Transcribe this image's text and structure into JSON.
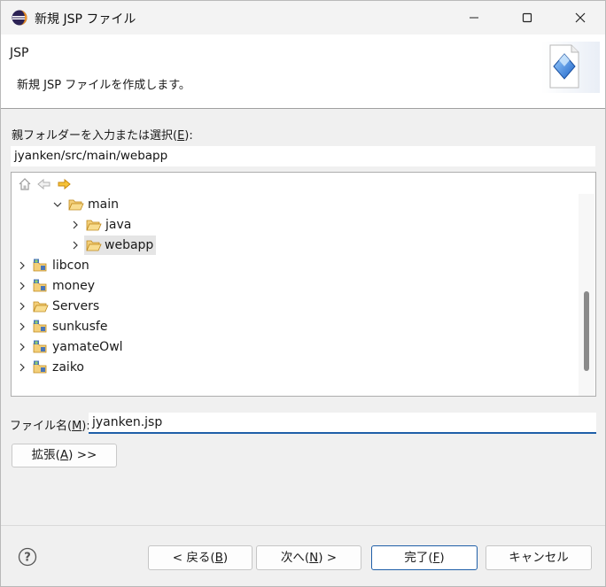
{
  "window": {
    "title": "新規 JSP ファイル"
  },
  "banner": {
    "title": "JSP",
    "description": "新規 JSP ファイルを作成します。"
  },
  "parent_folder": {
    "label_pre": "親フォルダーを入力または選択(",
    "label_key": "E",
    "label_post": "):",
    "value": "jyanken/src/main/webapp"
  },
  "tree": {
    "items": [
      {
        "label": "main",
        "kind": "folder-open",
        "expanded": true
      },
      {
        "label": "java",
        "kind": "folder-open",
        "expanded": false
      },
      {
        "label": "webapp",
        "kind": "folder-open",
        "expanded": false,
        "selected": true
      },
      {
        "label": "libcon",
        "kind": "project",
        "expanded": false
      },
      {
        "label": "money",
        "kind": "project",
        "expanded": false
      },
      {
        "label": "Servers",
        "kind": "folder-open",
        "expanded": false
      },
      {
        "label": "sunkusfe",
        "kind": "project",
        "expanded": false
      },
      {
        "label": "yamateOwl",
        "kind": "project",
        "expanded": false
      },
      {
        "label": "zaiko",
        "kind": "project",
        "expanded": false
      }
    ]
  },
  "file_name": {
    "label_pre": "ファイル名(",
    "label_key": "M",
    "label_post": "):",
    "value": "jyanken.jsp"
  },
  "buttons": {
    "advanced_pre": "拡張(",
    "advanced_key": "A",
    "advanced_post": ") >>",
    "back_pre": "< 戻る(",
    "back_key": "B",
    "back_post": ")",
    "next_pre": "次へ(",
    "next_key": "N",
    "next_post": ") >",
    "finish_pre": "完了(",
    "finish_key": "F",
    "finish_post": ")",
    "cancel": "キャンセル"
  },
  "colors": {
    "accent": "#1f5fa8",
    "folder": "#e8b04a",
    "selection": "#e5e5e5"
  },
  "icons": {
    "app": "eclipse-icon",
    "banner": "jsp-wizard-icon",
    "home": "home-icon",
    "back": "back-arrow-icon",
    "forward": "forward-arrow-icon",
    "help": "help-icon"
  }
}
